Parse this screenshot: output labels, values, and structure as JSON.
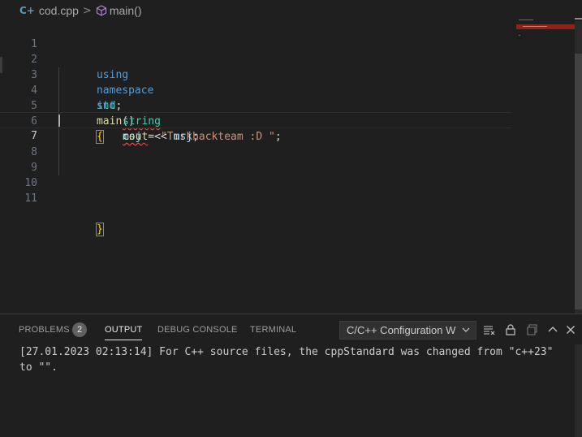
{
  "breadcrumb": {
    "file_icon": "C++ file icon",
    "file_name": "cod.cpp",
    "separator": ">",
    "symbol_icon": "cube-icon",
    "symbol_name": "main()"
  },
  "editor": {
    "active_line": 7,
    "line_numbers": [
      "1",
      "2",
      "3",
      "4",
      "5",
      "6",
      "7",
      "8",
      "9",
      "10",
      "11"
    ],
    "code": {
      "l1": {
        "kw_using": "using",
        "kw_namespace": "namespace",
        "ns": "std",
        "semi": ";"
      },
      "l3": {
        "type": "int",
        "fn": "main",
        "parens": "()",
        "brace": "{"
      },
      "l4": {
        "type": "string",
        "var": "msj",
        "op": " = ",
        "str": "\"Turkhackteam :D \"",
        "semi": ";"
      },
      "l5": {
        "fn": "cout",
        "op": " << ",
        "var": "msj",
        "semi": ";"
      },
      "l11": {
        "brace": "}"
      }
    }
  },
  "panel": {
    "tabs": [
      {
        "label": "PROBLEMS",
        "badge": "2"
      },
      {
        "label": "OUTPUT",
        "active": true
      },
      {
        "label": "DEBUG CONSOLE"
      },
      {
        "label": "TERMINAL"
      }
    ],
    "output_channel": "C/C++ Configuration W",
    "toolbar_icons": [
      "clear-output-icon",
      "lock-scroll-icon",
      "open-in-editor-icon",
      "maximize-panel-icon",
      "close-panel-icon"
    ],
    "output_text": "[27.01.2023 02:13:14] For C++ source files, the cppStandard was changed from \"c++23\" to \"\"."
  },
  "colors": {
    "background": "#1f1f1f",
    "keyword": "#569cd6",
    "type": "#4ec9b0",
    "function": "#dcdcaa",
    "variable": "#9cdcfe",
    "string": "#ce9178",
    "bracket": "#ffd700",
    "error_squiggle": "#f14c4c"
  }
}
